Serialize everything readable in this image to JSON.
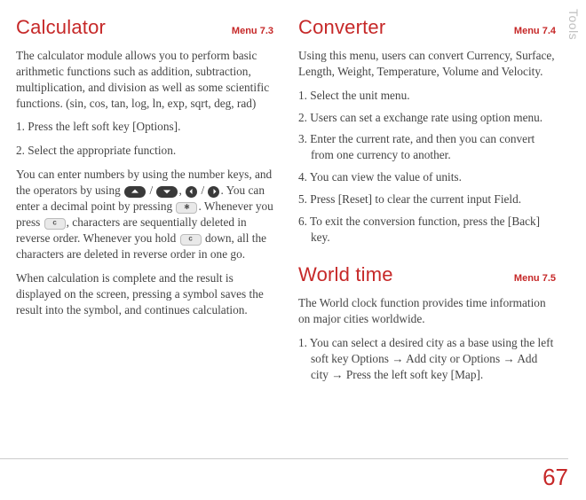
{
  "sideTab": "Tools",
  "pageNumber": "67",
  "left": {
    "calc": {
      "title": "Calculator",
      "menu": "Menu 7.3",
      "intro": "The calculator module allows you to perform basic arithmetic functions such as addition, subtraction, multiplication, and division as well as some scientific functions. (sin, cos, tan, log, ln, exp, sqrt, deg, rad)",
      "step1": "1. Press the left soft key [Options].",
      "step2": "2. Select the appropriate function.",
      "body_a": "You can enter numbers by using the number keys, and the operators by using ",
      "body_b": " / ",
      "body_c": ", ",
      "body_d": " / ",
      "body_e": ". You can enter a decimal point by pressing ",
      "body_f": ". Whenever you press ",
      "body_g": ", characters are sequentially deleted in reverse order. Whenever you hold ",
      "body_h": " down, all the characters are deleted in reverse order in one go.",
      "result": "When calculation is complete and the result is displayed on the screen, pressing a symbol saves the result into the symbol, and continues calculation."
    }
  },
  "right": {
    "conv": {
      "title": "Converter",
      "menu": "Menu 7.4",
      "intro": "Using this menu, users can convert Currency, Surface, Length, Weight, Temperature, Volume and Velocity.",
      "s1": "1. Select the unit menu.",
      "s2": "2. Users can set a exchange rate using option menu.",
      "s3": "3. Enter the current rate, and then you can convert from one currency to another.",
      "s4": "4. You can view the value of units.",
      "s5": "5. Press [Reset] to clear the current input Field.",
      "s6": "6. To exit the conversion function, press the [Back] key."
    },
    "world": {
      "title": "World time",
      "menu": "Menu 7.5",
      "intro": "The World clock function provides time information on major cities worldwide.",
      "s1": "1. You can select a desired city as a base using the left soft key Options →  Add city or Options → Add city → Press the left soft key [Map]."
    }
  }
}
